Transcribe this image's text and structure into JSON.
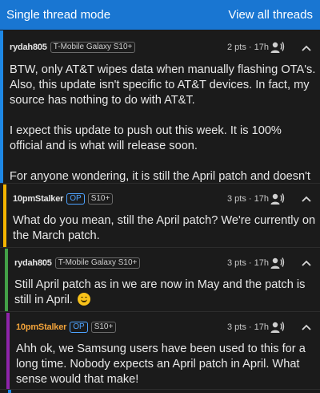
{
  "header": {
    "mode_label": "Single thread mode",
    "view_all_label": "View all threads"
  },
  "comments": [
    {
      "author": "rydah805",
      "flair": "T-Mobile Galaxy S10+",
      "is_op": false,
      "meta": "2 pts · 17h",
      "stripe_color": "#1e88e5",
      "paragraphs": [
        "BTW, only AT&T wipes data when manually flashing OTA's. Also, this update isn't specific to AT&T devices. In fact, my source has nothing to do with AT&T.",
        "I expect this update to push out this week. It is 100% official and is what will release soon.",
        "For anyone wondering, it is still the April patch and doesn't add the dedicated night mode in the camera."
      ]
    },
    {
      "author": "10pmStalker",
      "op_label": "OP",
      "flair": "S10+",
      "is_op": true,
      "meta": "3 pts · 17h",
      "stripe_color": "#f4b400",
      "paragraphs": [
        "What do you mean, still the April patch? We're currently on the March patch."
      ]
    },
    {
      "author": "rydah805",
      "flair": "T-Mobile Galaxy S10+",
      "is_op": false,
      "meta": "3 pts · 17h",
      "stripe_color": "#43a047",
      "paragraphs": [
        "Still April patch as in we are now in May and the patch is still in April."
      ],
      "emoji": "smiling-face"
    },
    {
      "author": "10pmStalker",
      "op_label": "OP",
      "flair": "S10+",
      "is_op": true,
      "meta": "3 pts · 17h",
      "stripe_color": "#8e24aa",
      "paragraphs": [
        "Ahh ok, we Samsung users have been used to this for a long time. Nobody expects an April patch in April. What sense would that make!"
      ]
    }
  ],
  "icons": {
    "voice": "text-to-speech-icon",
    "collapse": "chevron-up-icon",
    "emoji": "smiling-face-emoji"
  }
}
